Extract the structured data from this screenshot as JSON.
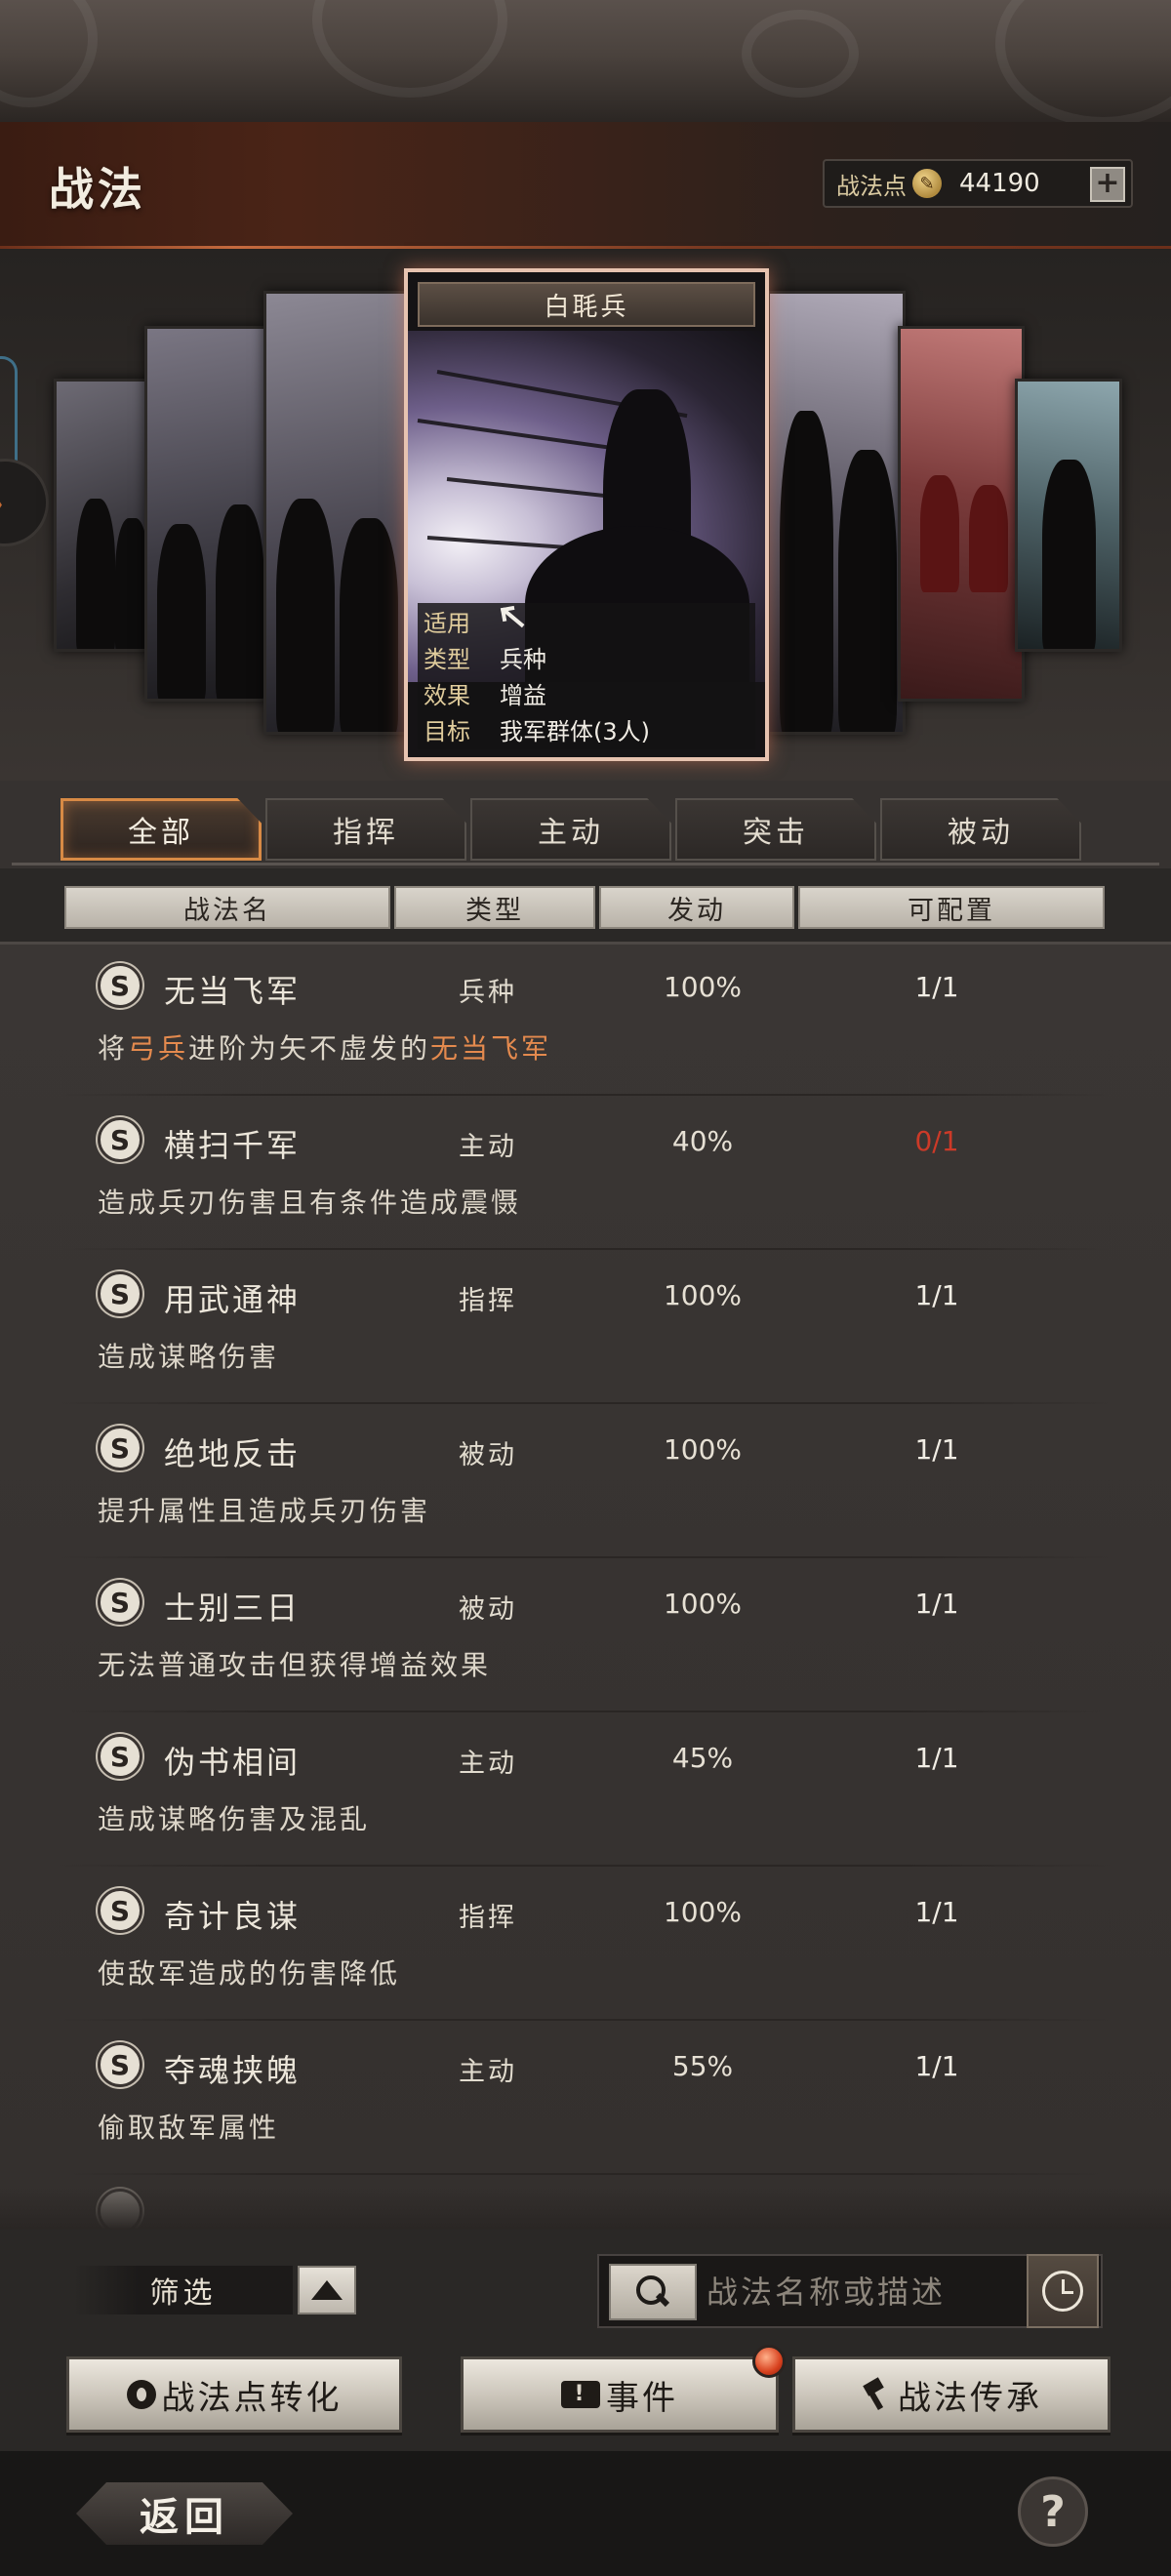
{
  "header": {
    "title": "战法",
    "points_label": "战法点",
    "points_value": "44190",
    "plus_label": "+"
  },
  "carousel": {
    "selected": {
      "name": "白毦兵",
      "info": [
        {
          "key": "适用",
          "value": "",
          "icon": "bow-icon"
        },
        {
          "key": "类型",
          "value": "兵种"
        },
        {
          "key": "效果",
          "value": "增益"
        },
        {
          "key": "目标",
          "value": "我军群体(3人)"
        }
      ]
    }
  },
  "tabs": [
    {
      "label": "全部",
      "active": true
    },
    {
      "label": "指挥",
      "active": false
    },
    {
      "label": "主动",
      "active": false
    },
    {
      "label": "突击",
      "active": false
    },
    {
      "label": "被动",
      "active": false
    }
  ],
  "table": {
    "headers": [
      "战法名",
      "类型",
      "发动",
      "可配置"
    ],
    "rows": [
      {
        "grade": "S",
        "name": "无当飞军",
        "type": "兵种",
        "rate": "100%",
        "config": "1/1",
        "desc_parts": [
          "将",
          "弓兵",
          "进阶为矢不虚发的",
          "无当飞军"
        ]
      },
      {
        "grade": "S",
        "name": "横扫千军",
        "type": "主动",
        "rate": "40%",
        "config": "0/1",
        "desc": "造成兵刃伤害且有条件造成震慑"
      },
      {
        "grade": "S",
        "name": "用武通神",
        "type": "指挥",
        "rate": "100%",
        "config": "1/1",
        "desc": "造成谋略伤害"
      },
      {
        "grade": "S",
        "name": "绝地反击",
        "type": "被动",
        "rate": "100%",
        "config": "1/1",
        "desc": "提升属性且造成兵刃伤害"
      },
      {
        "grade": "S",
        "name": "士别三日",
        "type": "被动",
        "rate": "100%",
        "config": "1/1",
        "desc": "无法普通攻击但获得增益效果"
      },
      {
        "grade": "S",
        "name": "伪书相间",
        "type": "主动",
        "rate": "45%",
        "config": "1/1",
        "desc": "造成谋略伤害及混乱"
      },
      {
        "grade": "S",
        "name": "奇计良谋",
        "type": "指挥",
        "rate": "100%",
        "config": "1/1",
        "desc": "使敌军造成的伤害降低"
      },
      {
        "grade": "S",
        "name": "夺魂挟魄",
        "type": "主动",
        "rate": "55%",
        "config": "1/1",
        "desc": "偷取敌军属性"
      }
    ]
  },
  "filter": {
    "label": "筛选"
  },
  "search": {
    "placeholder": "战法名称或描述"
  },
  "actions": {
    "convert": "战法点转化",
    "event": "事件",
    "event_icon_text": "!",
    "inherit": "战法传承"
  },
  "footer": {
    "back": "返回",
    "help": "?"
  },
  "colors": {
    "accent": "#d88a45",
    "highlight": "#e48a4e",
    "warning": "#cc3a28"
  }
}
